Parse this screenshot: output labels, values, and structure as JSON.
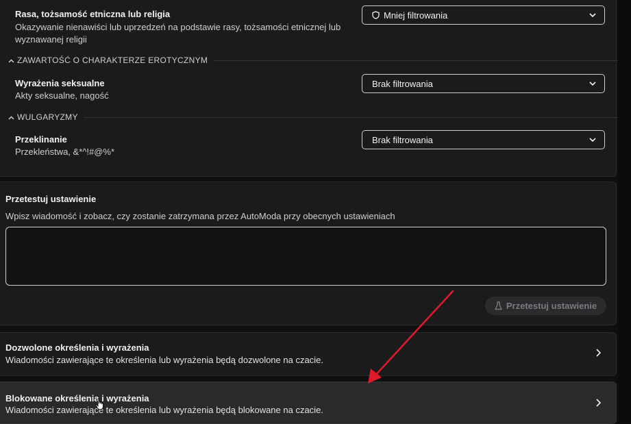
{
  "rules": [
    {
      "title": "Rasa, tożsamość etniczna lub religia",
      "desc": "Okazywanie nienawiści lub uprzedzeń na podstawie rasy, tożsamości etnicznej lub wyznawanej religii",
      "select": "Mniej filtrowania",
      "select_icon": "shield-icon"
    },
    {
      "title": "Wyrażenia seksualne",
      "desc": "Akty seksualne, nagość",
      "select": "Brak filtrowania"
    },
    {
      "title": "Przeklinanie",
      "desc": "Przekleństwa, &*^!#@%*",
      "select": "Brak filtrowania"
    }
  ],
  "sections": {
    "erotic": "ZAWARTOŚĆ O CHARAKTERZE EROTYCZNYM",
    "vulgar": "WULGARYZMY"
  },
  "test": {
    "title": "Przetestuj ustawienie",
    "desc": "Wpisz wiadomość i zobacz, czy zostanie zatrzymana przez AutoModa przy obecnych ustawieniach",
    "input_value": "",
    "button_label": "Przetestuj ustawienie",
    "button_icon": "flask-icon"
  },
  "allowed": {
    "title": "Dozwolone określenia i wyrażenia",
    "desc": "Wiadomości zawierające te określenia lub wyrażenia będą dozwolone na czacie."
  },
  "blocked": {
    "title": "Blokowane określenia i wyrażenia",
    "desc": "Wiadomości zawierające te określenia lub wyrażenia będą blokowane na czacie."
  },
  "colors": {
    "background": "#0f0f10",
    "panel": "#1b1b1c",
    "hover_panel": "#2a2a2c",
    "annotation_arrow": "#e0192b"
  }
}
